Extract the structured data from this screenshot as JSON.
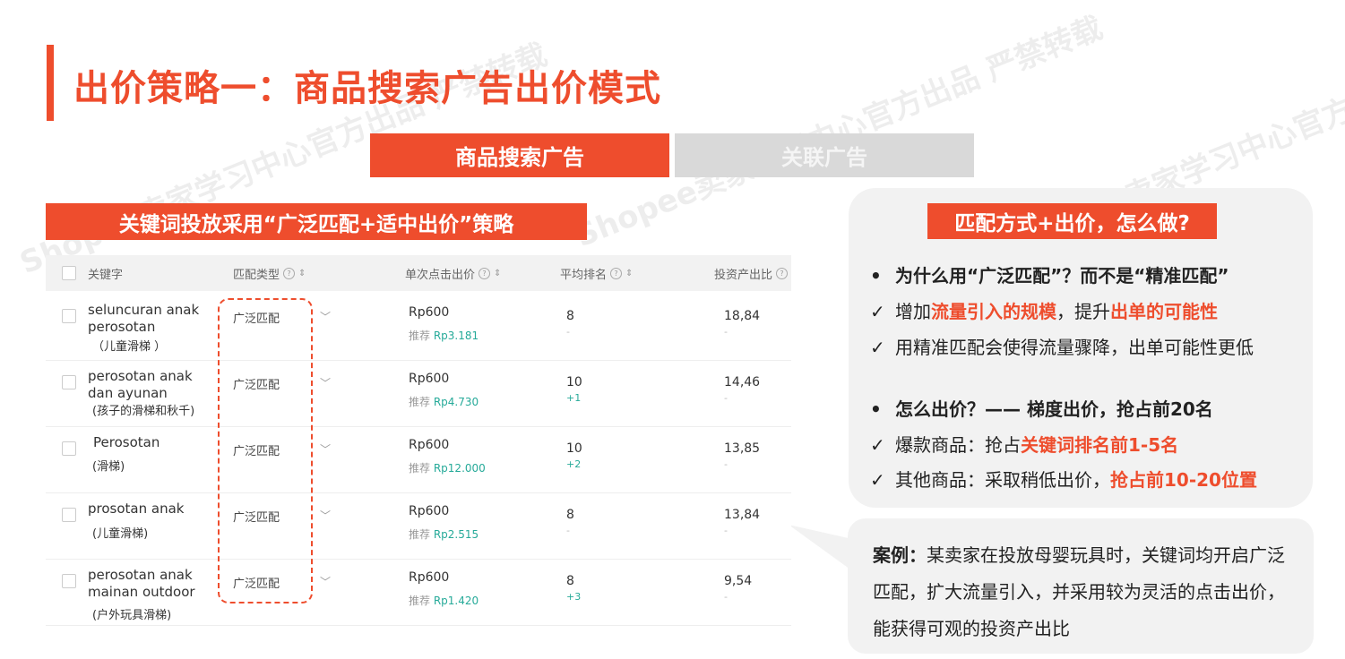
{
  "title": "出价策略一：商品搜索广告出价模式",
  "tabs": [
    {
      "label": "商品搜索广告",
      "active": true
    },
    {
      "label": "关联广告",
      "active": false
    }
  ],
  "strategy_banner": "关键词投放采用“广泛匹配+适中出价”策略",
  "table": {
    "headers": [
      "关键字",
      "匹配类型",
      "单次点击出价",
      "平均排名",
      "投资产出比"
    ],
    "rows": [
      {
        "keyword": "seluncuran anak perosotan",
        "cn": "（儿童滑梯 ）",
        "match": "广泛匹配",
        "bid": "Rp600",
        "rec_label": "推荐",
        "rec_value": "Rp3.181",
        "rank": "8",
        "rank_delta": "-",
        "roi": "18,84",
        "roi_sub": "-"
      },
      {
        "keyword": "perosotan anak dan ayunan",
        "cn": "(孩子的滑梯和秋千)",
        "match": "广泛匹配",
        "bid": "Rp600",
        "rec_label": "推荐",
        "rec_value": "Rp4.730",
        "rank": "10",
        "rank_delta": "+1",
        "roi": "14,46",
        "roi_sub": "-"
      },
      {
        "keyword": "Perosotan",
        "cn": "(滑梯)",
        "match": "广泛匹配",
        "bid": "Rp600",
        "rec_label": "推荐",
        "rec_value": "Rp12.000",
        "rank": "10",
        "rank_delta": "+2",
        "roi": "13,85",
        "roi_sub": "-"
      },
      {
        "keyword": "prosotan anak",
        "cn": "(儿童滑梯)",
        "match": "广泛匹配",
        "bid": "Rp600",
        "rec_label": "推荐",
        "rec_value": "Rp2.515",
        "rank": "8",
        "rank_delta": "-",
        "roi": "13,84",
        "roi_sub": "-"
      },
      {
        "keyword": "perosotan anak mainan outdoor",
        "cn": "(户外玩具滑梯)",
        "match": "广泛匹配",
        "bid": "Rp600",
        "rec_label": "推荐",
        "rec_value": "Rp1.420",
        "rank": "8",
        "rank_delta": "+3",
        "roi": "9,54",
        "roi_sub": "-"
      }
    ]
  },
  "panel": {
    "heading": "匹配方式+出价，怎么做?",
    "q1": "为什么用“广泛匹配”？而不是“精准匹配”",
    "l1_a": "增加",
    "l1_b": "流量引入的规模",
    "l1_c": "，提升",
    "l1_d": "出单的可能性",
    "l2": "用精准匹配会使得流量骤降，出单可能性更低",
    "q2": "怎么出价？—— 梯度出价，抢占前20名",
    "l3_a": "爆款商品：抢占",
    "l3_b": "关键词排名前1-5名",
    "l4_a": "其他商品：采取稍低出价，",
    "l4_b": "抢占前10-20位置"
  },
  "case": {
    "label": "案例：",
    "text": "某卖家在投放母婴玩具时，关键词均开启广泛匹配，扩大流量引入，并采用较为灵活的点击出价，能获得可观的投资产出比"
  },
  "watermarks": [
    "Shopee卖家学习中心官方出品 严禁转载",
    "Shopee卖家学习中心官方出品 严禁转载",
    "Shopee卖家学习中心官方出品 严禁转载"
  ],
  "colors": {
    "accent": "#ee4d2d",
    "panel_bg": "#f2f2f2",
    "green": "#26aa99"
  }
}
